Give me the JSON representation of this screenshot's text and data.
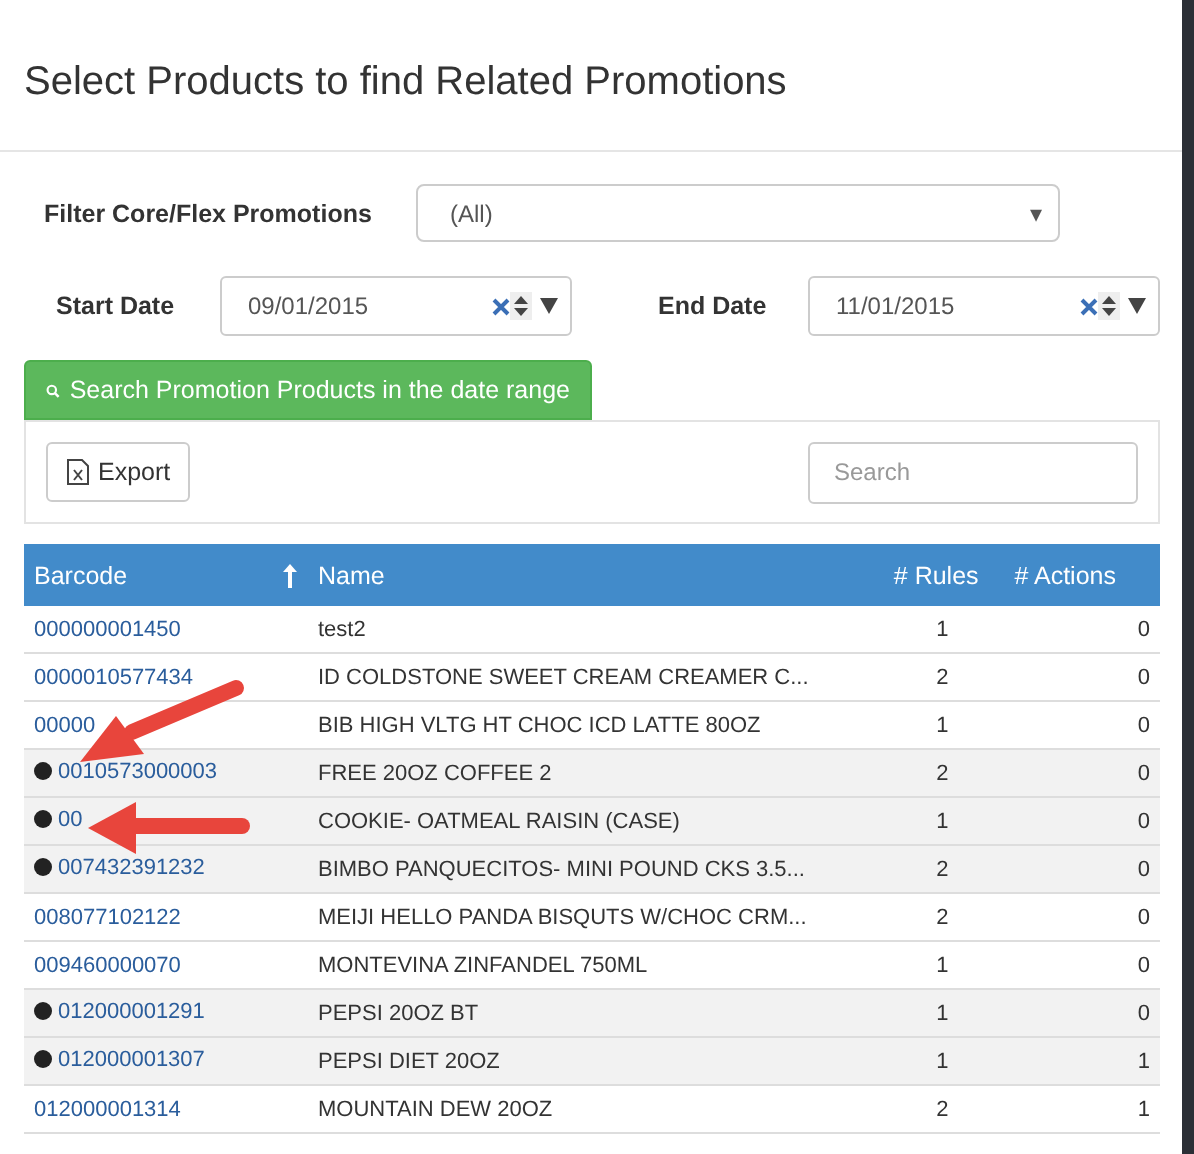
{
  "dialog": {
    "title": "Select Products to find Related Promotions"
  },
  "filter": {
    "label": "Filter Core/Flex Promotions",
    "value": "(All)",
    "caret": "▾"
  },
  "start_date": {
    "label": "Start Date",
    "value": "09/01/2015"
  },
  "end_date": {
    "label": "End Date",
    "value": "11/01/2015"
  },
  "search_button": {
    "label": "Search Promotion Products in the date range"
  },
  "toolbar": {
    "export_label": "Export",
    "search_placeholder": "Search"
  },
  "table": {
    "columns": [
      "Barcode",
      "Name",
      "# Rules",
      "# Actions"
    ],
    "rows": [
      {
        "barcode": "000000001450",
        "name": "test2",
        "rules": "1",
        "actions": "0",
        "selected": false
      },
      {
        "barcode": "0000010577434",
        "name": "ID COLDSTONE SWEET CREAM CREAMER C...",
        "rules": "2",
        "actions": "0",
        "selected": false
      },
      {
        "barcode": "00000",
        "name": "BIB HIGH VLTG HT CHOC ICD LATTE 80OZ",
        "rules": "1",
        "actions": "0",
        "selected": false
      },
      {
        "barcode": "0010573000003",
        "name": "FREE 20OZ COFFEE 2",
        "rules": "2",
        "actions": "0",
        "selected": true
      },
      {
        "barcode": "00",
        "name": "COOKIE- OATMEAL RAISIN (CASE)",
        "rules": "1",
        "actions": "0",
        "selected": true
      },
      {
        "barcode": "007432391232",
        "name": "BIMBO PANQUECITOS- MINI POUND CKS 3.5...",
        "rules": "2",
        "actions": "0",
        "selected": true
      },
      {
        "barcode": "008077102122",
        "name": "MEIJI HELLO PANDA BISQUTS W/CHOC CRM...",
        "rules": "2",
        "actions": "0",
        "selected": false
      },
      {
        "barcode": "009460000070",
        "name": "MONTEVINA ZINFANDEL 750ML",
        "rules": "1",
        "actions": "0",
        "selected": false
      },
      {
        "barcode": "012000001291",
        "name": "PEPSI 20OZ BT",
        "rules": "1",
        "actions": "0",
        "selected": true
      },
      {
        "barcode": "012000001307",
        "name": "PEPSI DIET 20OZ",
        "rules": "1",
        "actions": "1",
        "selected": true
      },
      {
        "barcode": "012000001314",
        "name": "MOUNTAIN DEW 20OZ",
        "rules": "2",
        "actions": "1",
        "selected": false
      }
    ]
  }
}
